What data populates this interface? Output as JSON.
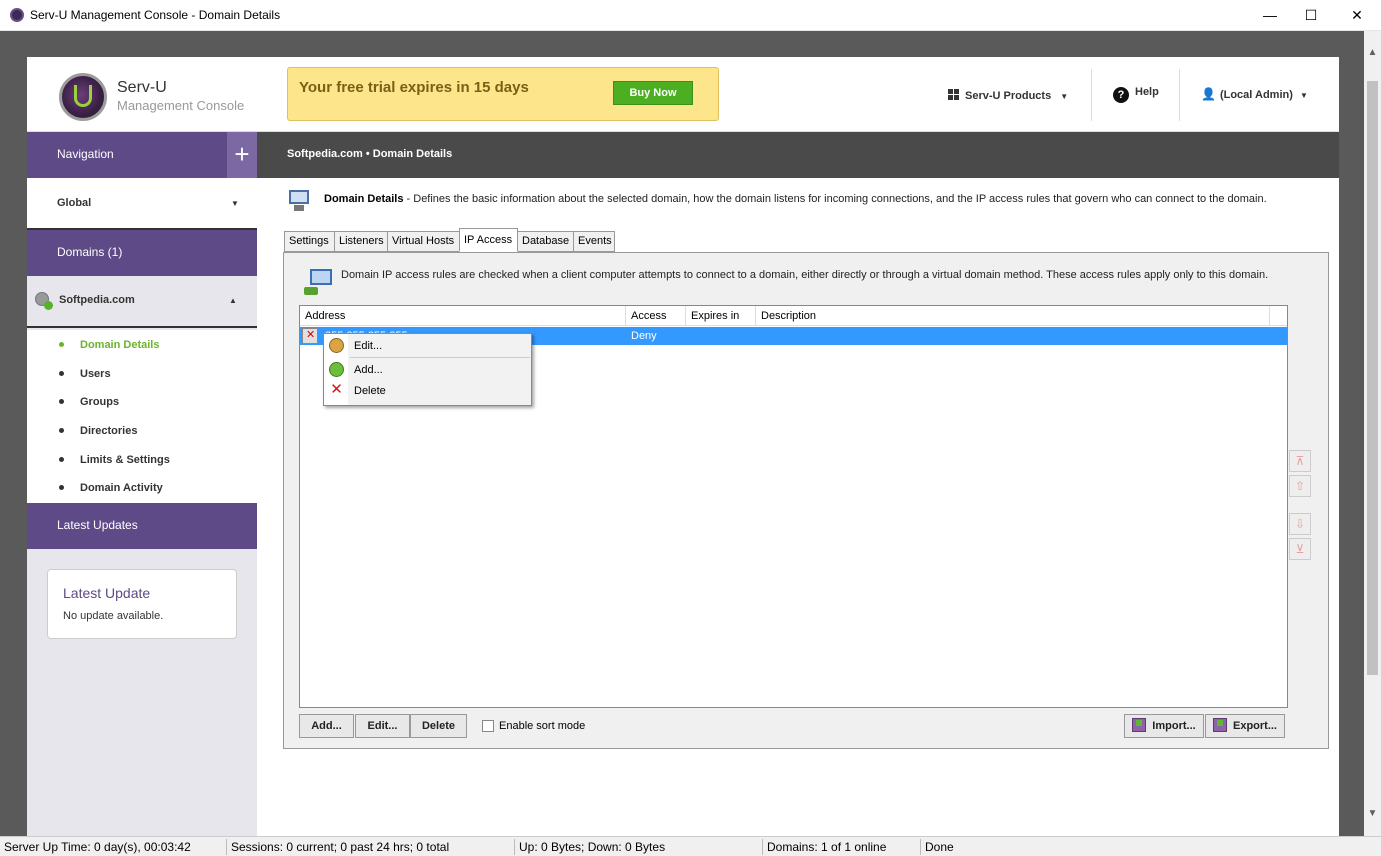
{
  "window": {
    "title": "Serv-U Management Console - Domain Details"
  },
  "header": {
    "brand": "Serv-U",
    "subtitle": "Management Console",
    "trial_message": "Your free trial expires in 15 days",
    "buy_now": "Buy Now",
    "products": "Serv-U Products",
    "help": "Help",
    "user": "(Local Admin)"
  },
  "sidebar": {
    "navigation": "Navigation",
    "global": "Global",
    "domains": "Domains (1)",
    "domain_name": "Softpedia.com",
    "items": [
      {
        "label": "Domain Details",
        "active": true
      },
      {
        "label": "Users",
        "active": false
      },
      {
        "label": "Groups",
        "active": false
      },
      {
        "label": "Directories",
        "active": false
      },
      {
        "label": "Limits & Settings",
        "active": false
      },
      {
        "label": "Domain Activity",
        "active": false
      }
    ],
    "latest_updates": "Latest Updates",
    "update_box": {
      "title": "Latest Update",
      "text": "No update available."
    }
  },
  "main": {
    "breadcrumb": "Softpedia.com • Domain Details",
    "desc_title": "Domain Details",
    "desc_text": " - Defines the basic information about the selected domain, how the domain listens for incoming connections, and the IP access rules that govern who can connect to the domain.",
    "tabs": [
      "Settings",
      "Listeners",
      "Virtual Hosts",
      "IP Access",
      "Database",
      "Events"
    ],
    "active_tab": "IP Access",
    "panel_desc": "Domain IP access rules are checked when a client computer attempts to connect to a domain, either directly or through a virtual domain method. These access rules apply only to this domain.",
    "columns": [
      "Address",
      "Access",
      "Expires in",
      "Description"
    ],
    "rows": [
      {
        "address": "255.255.255.255",
        "access": "Deny",
        "expires": "",
        "description": ""
      }
    ],
    "context_menu": [
      "Edit...",
      "Add...",
      "Delete"
    ],
    "buttons": {
      "add": "Add...",
      "edit": "Edit...",
      "delete": "Delete",
      "sort_mode": "Enable sort mode",
      "import": "Import...",
      "export": "Export..."
    }
  },
  "statusbar": {
    "uptime": "Server Up Time: 0 day(s), 00:03:42",
    "sessions": "Sessions: 0 current; 0 past 24 hrs; 0 total",
    "traffic": "Up: 0 Bytes; Down: 0 Bytes",
    "domains": "Domains: 1 of 1 online",
    "status": "Done"
  },
  "colors": {
    "purple": "#5e4a86",
    "green": "#6cb32d",
    "selection": "#3399ff"
  }
}
